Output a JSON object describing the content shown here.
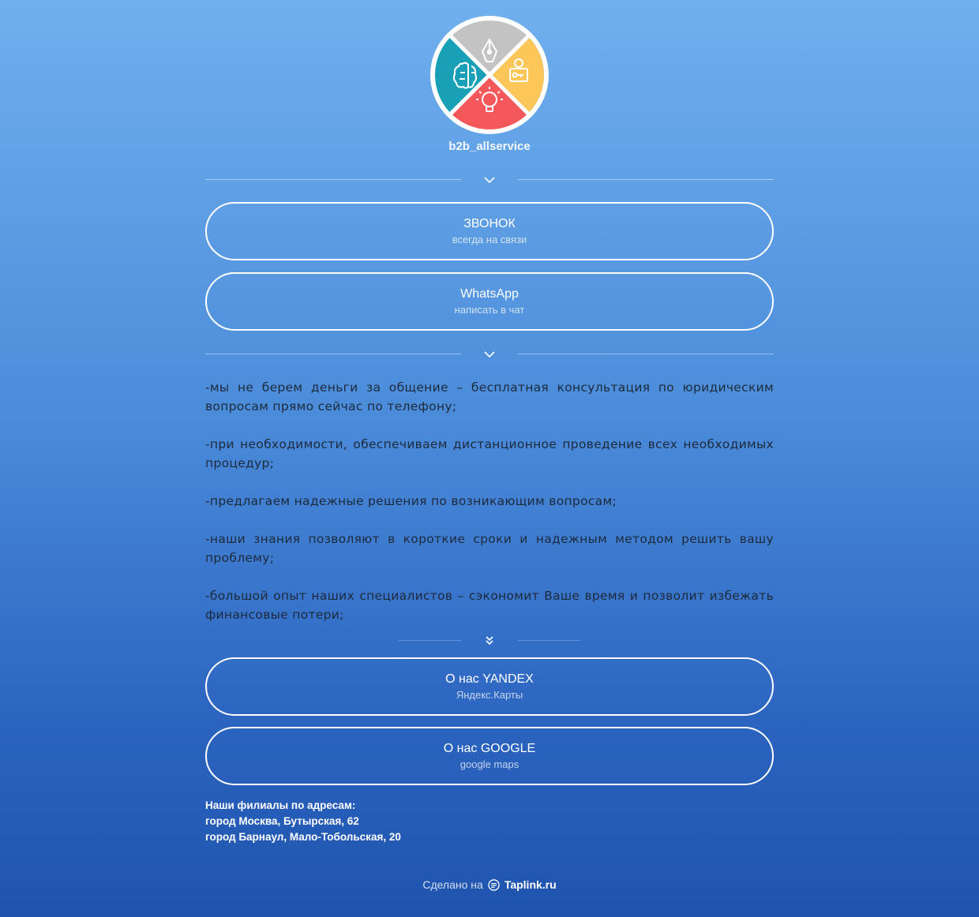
{
  "profile": {
    "username": "b2b_allservice",
    "avatar_icons": [
      "pen-nib-icon",
      "user-key-icon",
      "lightbulb-icon",
      "brain-icon"
    ],
    "avatar_colors": {
      "top": "#c3c3c3",
      "right": "#fcc659",
      "bottom": "#f4585a",
      "left": "#1aa0b6"
    }
  },
  "buttons": {
    "call": {
      "title": "ЗВОНОК",
      "subtitle": "всегда на связи"
    },
    "whatsapp": {
      "title": "WhatsApp",
      "subtitle": "написать в чат"
    },
    "yandex": {
      "title": "О нас YANDEX",
      "subtitle": "Яндекс.Карты"
    },
    "google": {
      "title": "О нас GOOGLE",
      "subtitle": "google maps"
    }
  },
  "description": [
    "-мы не берем деньги за общение – бесплатная консультация по юридическим вопросам прямо сейчас по телефону;",
    "-при необходимости, обеспечиваем дистанционное проведение всех необходимых процедур;",
    "-предлагаем надежные решения по возникающим вопросам;",
    "-наши знания позволяют в короткие сроки и надежным методом решить вашу проблему;",
    "-большой опыт наших специалистов – сэкономит Ваше время и позволит избежать финансовые потери;"
  ],
  "branches": {
    "heading": "Наши филиалы по адресам:",
    "items": [
      "город Москва, Бутырская, 62",
      "город Барнаул, Мало-Тобольская, 20"
    ]
  },
  "footer": {
    "made_on": "Сделано на",
    "brand": "Taplink.ru"
  },
  "colors": {
    "text_dark": "#1d2a3c",
    "button_border": "#ffffff"
  }
}
